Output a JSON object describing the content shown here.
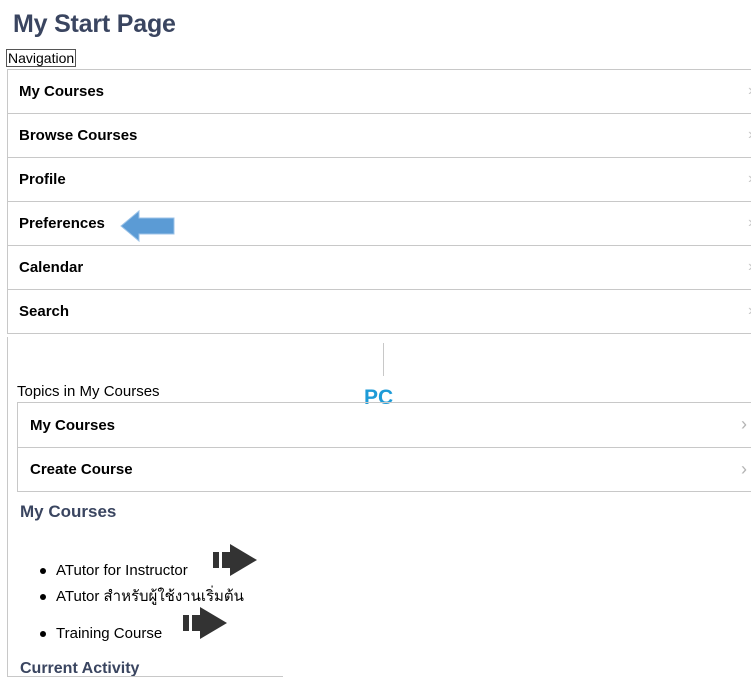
{
  "page": {
    "title": "My Start Page"
  },
  "navigation": {
    "label": "Navigation",
    "items": [
      {
        "label": "My Courses"
      },
      {
        "label": "Browse Courses"
      },
      {
        "label": "Profile"
      },
      {
        "label": "Preferences"
      },
      {
        "label": "Calendar"
      },
      {
        "label": "Search"
      }
    ]
  },
  "annotation": {
    "pc_label": "PC",
    "arrow_color": "#5b9bd5",
    "pointer_color": "#333333"
  },
  "topics": {
    "label": "Topics in My Courses",
    "items": [
      {
        "label": "My Courses"
      },
      {
        "label": "Create Course"
      }
    ]
  },
  "my_courses": {
    "heading": "My Courses",
    "items": [
      {
        "label": "ATutor for Instructor"
      },
      {
        "label": "ATutor สำหรับผู้ใช้งานเริ่มต้น"
      },
      {
        "label": "Training Course"
      }
    ]
  },
  "current_activity": {
    "heading": "Current Activity"
  },
  "colors": {
    "heading": "#3a4560",
    "pc": "#1e9bd7",
    "border": "#c8c8c8"
  }
}
